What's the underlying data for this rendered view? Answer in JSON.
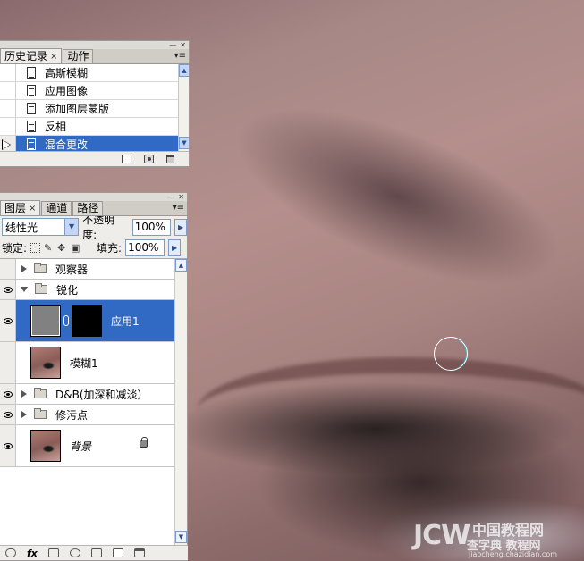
{
  "history_panel": {
    "tabs": [
      {
        "label": "历史记录",
        "close": "×"
      },
      {
        "label": "动作"
      }
    ],
    "items": [
      {
        "label": "高斯模糊"
      },
      {
        "label": "应用图像"
      },
      {
        "label": "添加图层蒙版"
      },
      {
        "label": "反相"
      },
      {
        "label": "混合更改",
        "selected": true
      }
    ],
    "footer_icons": [
      "new-document-icon",
      "camera-snapshot-icon",
      "trash-icon"
    ]
  },
  "layers_panel": {
    "tabs": [
      {
        "label": "图层",
        "close": "×"
      },
      {
        "label": "通道"
      },
      {
        "label": "路径"
      }
    ],
    "blend_mode": "线性光",
    "opacity_label": "不透明度:",
    "opacity_value": "100%",
    "lock_label": "锁定:",
    "fill_label": "填充:",
    "fill_value": "100%",
    "layers": [
      {
        "name": "观察器",
        "type": "group",
        "expanded": false,
        "visible": false
      },
      {
        "name": "锐化",
        "type": "group",
        "expanded": true,
        "visible": true
      },
      {
        "name": "应用1",
        "type": "layer",
        "mask": true,
        "selected": true,
        "visible": true
      },
      {
        "name": "模糊1",
        "type": "layer",
        "visible": false
      },
      {
        "name": "D&B(加深和减淡）",
        "type": "group",
        "expanded": false,
        "visible": true
      },
      {
        "name": "修污点",
        "type": "group",
        "expanded": false,
        "visible": true
      },
      {
        "name": "背景",
        "type": "layer",
        "locked": true,
        "visible": true
      }
    ],
    "footer_icons": [
      "link-icon",
      "fx-icon",
      "mask-icon",
      "adjustment-icon",
      "group-icon",
      "new-layer-icon",
      "trash-icon"
    ],
    "fx_label": "fx"
  },
  "watermark": {
    "jcw": "JCW",
    "cn": "中国教程网",
    "sub": "查字典 教程网",
    "url": "jiaocheng.chazidian.com"
  }
}
